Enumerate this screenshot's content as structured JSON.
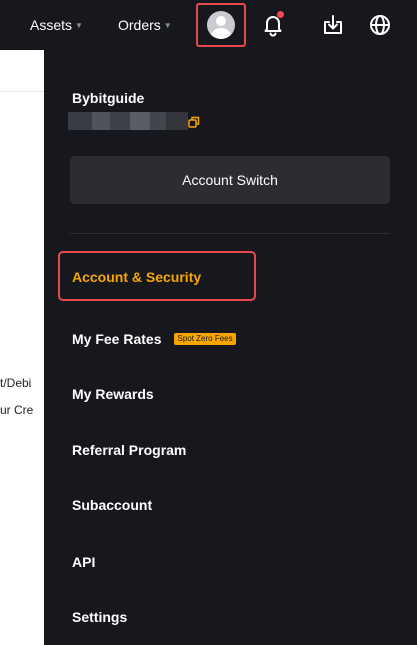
{
  "header": {
    "nav": [
      {
        "label": "Assets"
      },
      {
        "label": "Orders"
      }
    ],
    "notification_dot": true
  },
  "background_page": {
    "lines": [
      "t/Debi",
      "ur Cre"
    ]
  },
  "account_menu": {
    "username": "Bybitguide",
    "account_switch_label": "Account Switch",
    "items": [
      {
        "label": "Account & Security",
        "active": true
      },
      {
        "label": "My Fee Rates",
        "badge": "Spot Zero Fees"
      },
      {
        "label": "My Rewards"
      },
      {
        "label": "Referral Program"
      },
      {
        "label": "Subaccount"
      },
      {
        "label": "API"
      },
      {
        "label": "Settings"
      }
    ]
  },
  "colors": {
    "header_bg": "#17181e",
    "accent": "#f7a600",
    "highlight_box": "#e5484d",
    "notification": "#f6465d"
  },
  "icons": [
    "avatar",
    "bell-icon",
    "download-icon",
    "globe-icon",
    "copy-icon"
  ]
}
